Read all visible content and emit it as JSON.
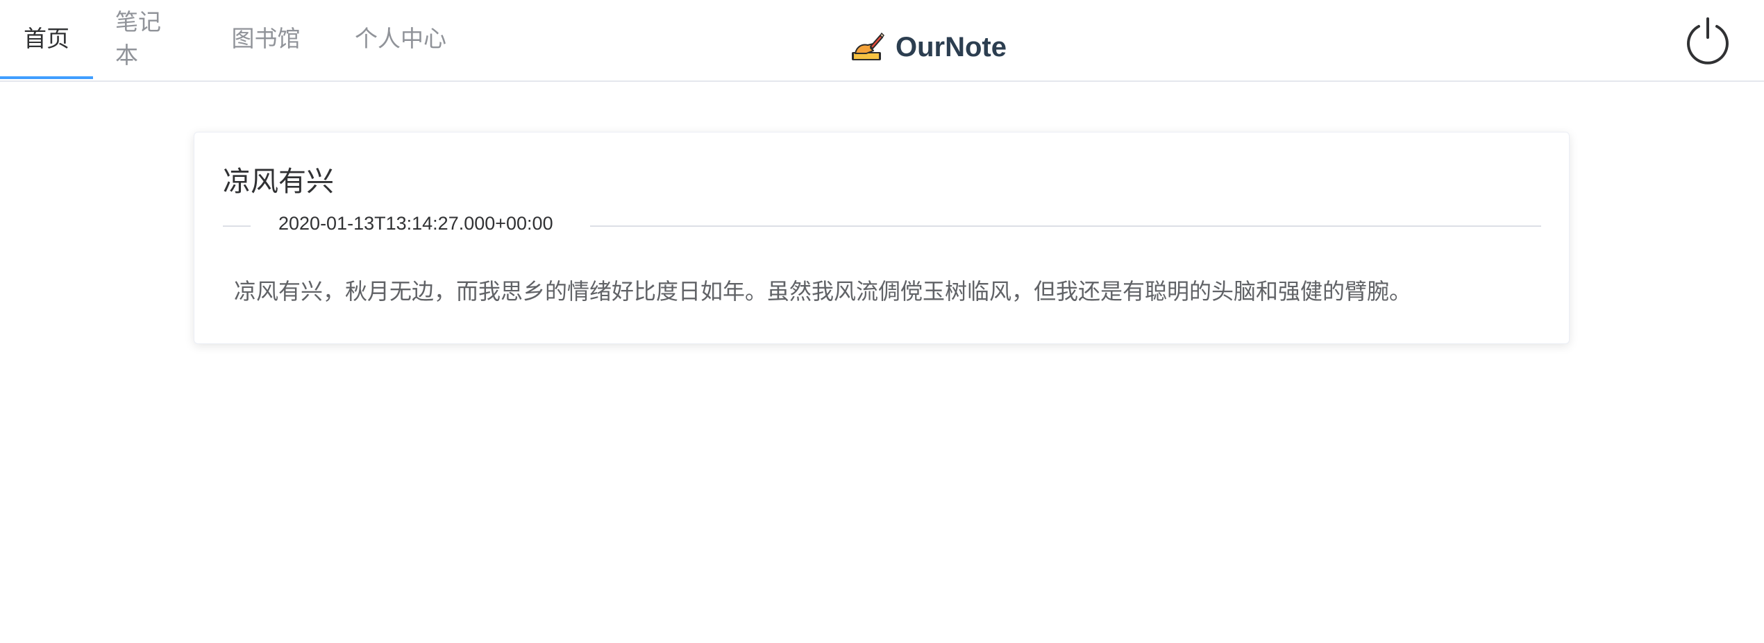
{
  "nav": {
    "tabs": [
      {
        "label": "首页",
        "active": true
      },
      {
        "label": "笔记本",
        "active": false
      },
      {
        "label": "图书馆",
        "active": false
      },
      {
        "label": "个人中心",
        "active": false
      }
    ]
  },
  "brand": {
    "name": "OurNote",
    "icon": "writing-hand-icon"
  },
  "header": {
    "power_icon": "power-icon"
  },
  "note": {
    "title": "凉风有兴",
    "date": "2020-01-13T13:14:27.000+00:00",
    "content": "凉风有兴，秋月无边，而我思乡的情绪好比度日如年。虽然我风流倜傥玉树临风，但我还是有聪明的头脑和强健的臂腕。"
  },
  "colors": {
    "accent": "#409eff",
    "brand_text": "#2c3e50",
    "tab_inactive": "#909399",
    "tab_active": "#303133"
  }
}
